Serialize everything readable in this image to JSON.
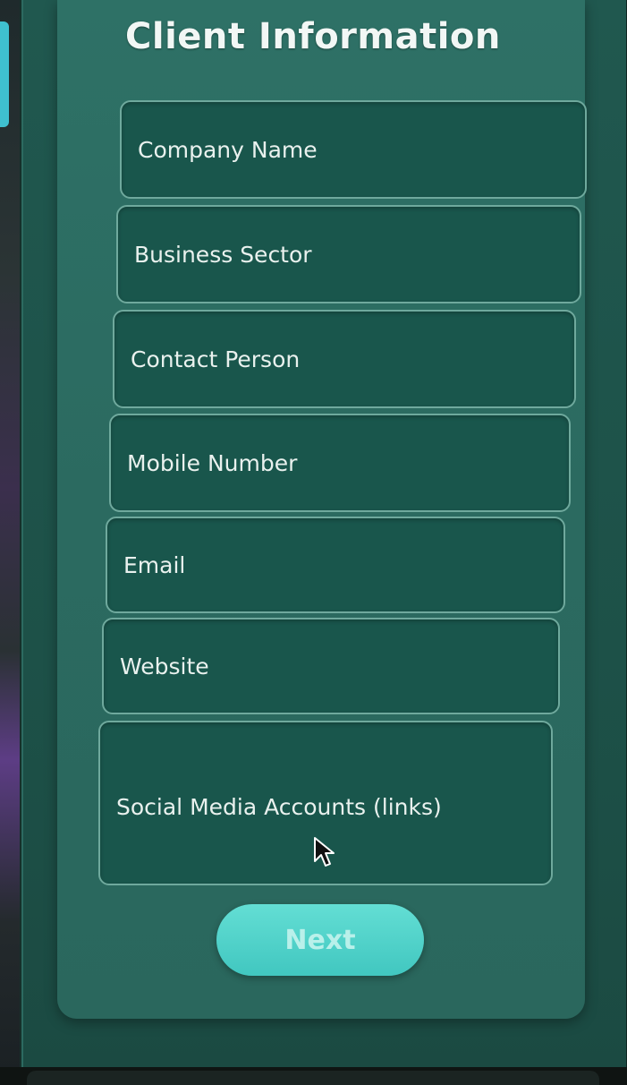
{
  "form": {
    "title": "Client Information",
    "fields": [
      {
        "placeholder": "Company Name"
      },
      {
        "placeholder": "Business Sector"
      },
      {
        "placeholder": "Contact Person"
      },
      {
        "placeholder": "Mobile Number"
      },
      {
        "placeholder": "Email"
      },
      {
        "placeholder": "Website"
      },
      {
        "placeholder": "Social Media Accounts (links)"
      }
    ],
    "next_label": "Next"
  },
  "icons": {
    "cursor": "mouse-pointer-icon"
  },
  "colors": {
    "panel_bg": "#2e7166",
    "field_bg": "#19564c",
    "field_border": "#6fa99d",
    "button_bg": "#4fd2c9",
    "title_text": "#f2f7f5"
  }
}
